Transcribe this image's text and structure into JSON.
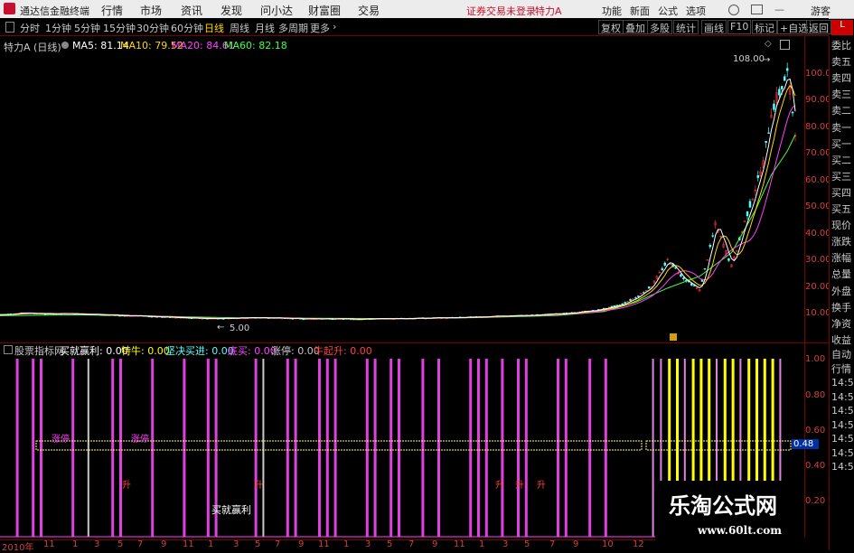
{
  "app": {
    "title": "通达信金融终端"
  },
  "menu": [
    "行情",
    "市场",
    "资讯",
    "发现",
    "问小达",
    "财富圈",
    "交易"
  ],
  "status": {
    "trade_warning": "证券交易未登录",
    "stock": "特力A"
  },
  "menu_right": [
    "功能",
    "新面",
    "公式",
    "选项",
    "游客"
  ],
  "periods": [
    "分时",
    "1分钟",
    "5分钟",
    "15分钟",
    "30分钟",
    "60分钟",
    "日线",
    "周线",
    "月线",
    "多周期",
    "更多"
  ],
  "active_period": "日线",
  "right_buttons": [
    "复权",
    "叠加",
    "多股",
    "统计",
    "画线",
    "F10",
    "标记",
    "+自选",
    "返回"
  ],
  "ma_bar": {
    "stock": "特力A (日线)",
    "ma5": "MA5: 81.14",
    "ma10": "MA10: 79.52",
    "ma20": "MA20: 84.61",
    "ma60": "MA60: 82.18"
  },
  "annotations": {
    "high": "108.00",
    "low": "5.00"
  },
  "y_ticks": [
    "100.00",
    "90.00",
    "80.00",
    "70.00",
    "60.00",
    "50.00",
    "40.00",
    "30.00",
    "20.00",
    "10.00"
  ],
  "sidebar": [
    "委比",
    "卖五",
    "卖四",
    "卖三",
    "卖二",
    "卖一",
    "买一",
    "买二",
    "买三",
    "买四",
    "买五",
    "现价",
    "涨跌",
    "涨幅",
    "总量",
    "外盘",
    "换手",
    "净资",
    "收益"
  ],
  "indicator": {
    "name": "股票指标网",
    "buy": "买就赢利: 0.00",
    "niu": "特牛: 0.00",
    "jianjue": "坚决买进: 0.00",
    "dimai": "底买: 0.00",
    "zhangting": "涨停: 0.00",
    "niuqi": "牛起升: 0.00"
  },
  "ind_y_ticks": [
    "1.00",
    "0.80",
    "0.60",
    "0.40",
    "0.20"
  ],
  "ind_current": "0.48",
  "side2": [
    "自动",
    "行情",
    "14:5",
    "14:5",
    "14:5",
    "14:5",
    "14:5",
    "14:5",
    "14:5"
  ],
  "ind_labels": {
    "buy_label": "买就赢利",
    "sheng": "升",
    "zhangting": "涨停"
  },
  "x_ticks": [
    "2010年",
    "11",
    "1",
    "3",
    "5",
    "7",
    "9",
    "11",
    "1",
    "3",
    "5",
    "7",
    "9",
    "11",
    "1",
    "3",
    "5",
    "7",
    "9",
    "11",
    "1",
    "3",
    "5",
    "7",
    "9",
    "10",
    "12"
  ],
  "watermark": {
    "brand": "乐淘公式网",
    "url": "www.60lt.com"
  },
  "colors": {
    "bg": "#000000",
    "border": "#7a0000",
    "ma5": "#ffffff",
    "ma10": "#ffd700",
    "ma20": "#ff40ff",
    "ma60": "#40ff40",
    "up": "#ff3030",
    "down": "#54ffff",
    "magenta": "#e040e0",
    "yellow": "#ffff00"
  },
  "chart_data": {
    "type": "line",
    "price_series": [
      [
        0,
        5.6
      ],
      [
        3,
        6.4
      ],
      [
        6,
        6.0
      ],
      [
        9,
        6.1
      ],
      [
        12,
        5.7
      ],
      [
        15,
        5.3
      ],
      [
        18,
        5.1
      ],
      [
        21,
        4.6
      ],
      [
        24,
        4.2
      ],
      [
        27,
        4.0
      ],
      [
        30,
        4.3
      ],
      [
        33,
        4.4
      ],
      [
        36,
        4.1
      ],
      [
        39,
        3.9
      ],
      [
        42,
        3.9
      ],
      [
        45,
        3.8
      ],
      [
        48,
        3.9
      ],
      [
        51,
        4.1
      ],
      [
        54,
        4.2
      ],
      [
        57,
        4.4
      ],
      [
        60,
        4.7
      ],
      [
        63,
        5.0
      ],
      [
        66,
        5.3
      ],
      [
        69,
        5.8
      ],
      [
        72,
        6.4
      ],
      [
        75,
        7.5
      ],
      [
        78,
        9.8
      ],
      [
        80,
        13
      ],
      [
        82,
        18
      ],
      [
        84,
        29
      ],
      [
        86,
        21
      ],
      [
        88,
        16
      ],
      [
        90,
        44
      ],
      [
        92,
        26
      ],
      [
        94,
        49
      ],
      [
        96,
        70
      ],
      [
        97,
        92
      ],
      [
        98,
        100
      ],
      [
        99,
        108
      ],
      [
        100,
        84
      ]
    ],
    "ma60_series": [
      [
        0,
        5.2
      ],
      [
        10,
        5.6
      ],
      [
        20,
        5.0
      ],
      [
        30,
        4.3
      ],
      [
        40,
        4.1
      ],
      [
        50,
        4.0
      ],
      [
        60,
        4.4
      ],
      [
        70,
        5.3
      ],
      [
        76,
        7.0
      ],
      [
        80,
        11
      ],
      [
        84,
        17
      ],
      [
        88,
        22
      ],
      [
        92,
        32
      ],
      [
        95,
        50
      ],
      [
        97,
        65
      ],
      [
        99,
        75
      ],
      [
        100,
        82
      ]
    ],
    "ylim": [
      0,
      110
    ],
    "indicator_bars": {
      "magenta": [
        2,
        4,
        5,
        9,
        14,
        15,
        19,
        23,
        26,
        27,
        32,
        36,
        37,
        40,
        41,
        42,
        46,
        47,
        49,
        50,
        53,
        55,
        59,
        60,
        61,
        63,
        65,
        66,
        70,
        71,
        74,
        76
      ],
      "white": [
        11,
        33
      ],
      "yellow": [
        84,
        85,
        87,
        88,
        89,
        91,
        92,
        94,
        95,
        96,
        97
      ],
      "pink_light": [
        82,
        83,
        86,
        90,
        93,
        98
      ]
    }
  }
}
